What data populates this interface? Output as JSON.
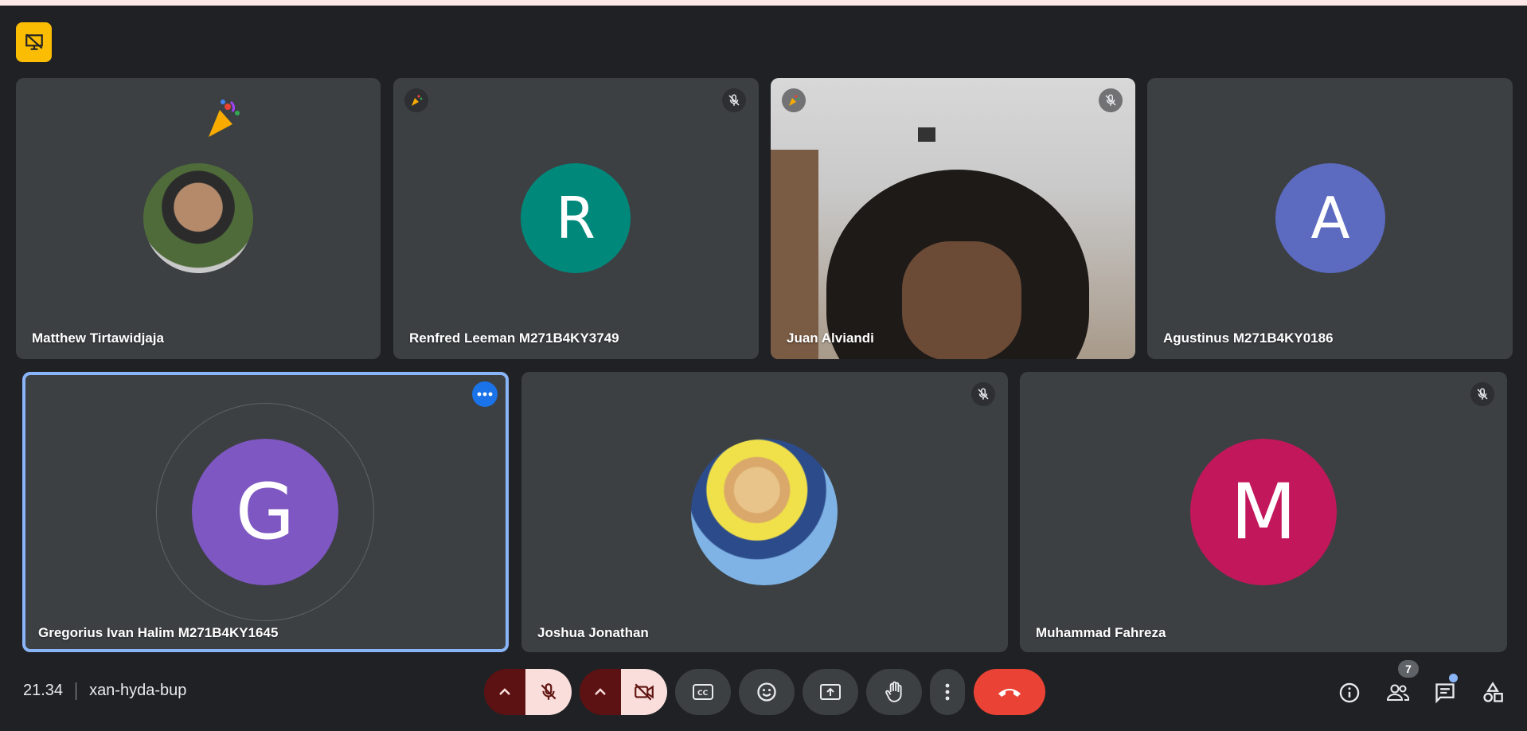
{
  "participants_row1": [
    {
      "name": "Matthew Tirtawidjaja",
      "type": "photo"
    },
    {
      "name": "Renfred Leeman M271B4KY3749",
      "initial": "R",
      "color": "#00897b"
    },
    {
      "name": "Juan Alviandi",
      "type": "video"
    },
    {
      "name": "Agustinus M271B4KY0186",
      "initial": "A",
      "color": "#5c6bc0"
    }
  ],
  "participants_row2": [
    {
      "name": "Gregorius Ivan Halim M271B4KY1645",
      "initial": "G",
      "color": "#7e57c2"
    },
    {
      "name": "Joshua Jonathan",
      "type": "photo"
    },
    {
      "name": "Muhammad Fahreza",
      "initial": "M",
      "color": "#c2185b"
    }
  ],
  "meeting": {
    "time": "21.34",
    "code": "xan-hyda-bup"
  },
  "people_count": "7",
  "icons": {
    "top_badge": "presentation-off-icon",
    "mic": "mic-off-icon",
    "camera": "camera-off-icon",
    "captions": "captions-icon",
    "emoji": "emoji-icon",
    "present": "present-screen-icon",
    "hand": "raise-hand-icon",
    "more": "more-vertical-icon",
    "end": "end-call-icon",
    "info": "info-icon",
    "people": "people-icon",
    "chat": "chat-icon",
    "activities": "activities-icon"
  },
  "colors": {
    "background": "#202124",
    "tile": "#3c4043",
    "end_call": "#ea4335",
    "active_outline": "#8ab4f8",
    "accent_yellow": "#fbbc04"
  }
}
